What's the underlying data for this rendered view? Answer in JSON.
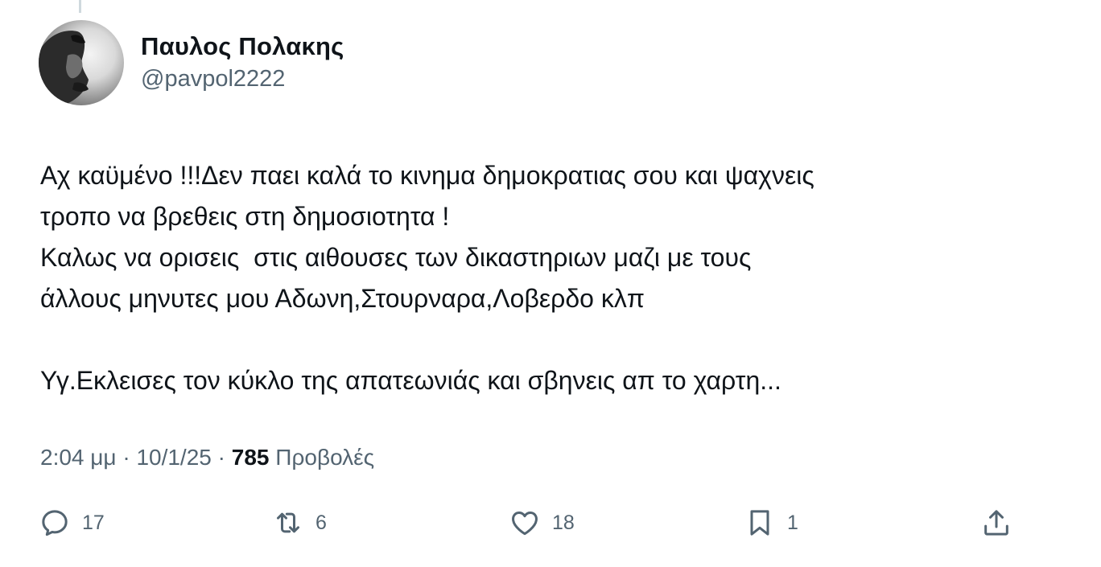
{
  "author": {
    "display_name": "Παυλος Πολακης",
    "handle": "@pavpol2222",
    "avatar_icon": "profile-photo"
  },
  "tweet": {
    "text": "Αχ καϋμένο !!!Δεν παει καλά το κινημα δημοκρατιας σου και ψαχνεις\nτροπο να βρεθεις στη δημοσιοτητα !\nΚαλως να ορισεις  στις αιθουσες των δικαστηριων μαζι με τους\nάλλους μηνυτες μου Αδωνη,Στουρναρα,Λοβερδο κλπ\n\nΥγ.Εκλεισες τον κύκλο της απατεωνιάς και σβηνεις απ το χαρτη..."
  },
  "meta": {
    "time": "2:04 μμ",
    "separator": " · ",
    "date": "10/1/25",
    "views_count": "785",
    "views_label": " Προβολές"
  },
  "actions": {
    "replies": "17",
    "reposts": "6",
    "likes": "18",
    "bookmarks": "1"
  },
  "colors": {
    "text": "#0f1419",
    "secondary": "#536471",
    "icon": "#536471"
  }
}
